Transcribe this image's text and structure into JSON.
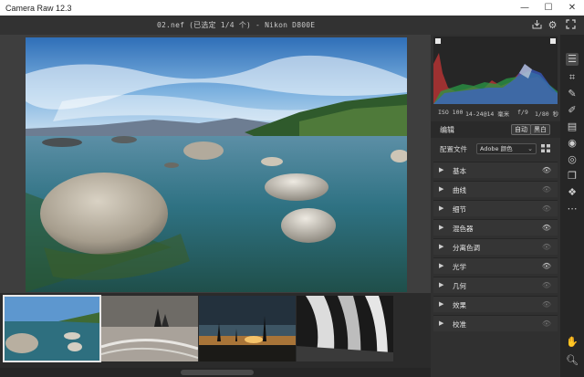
{
  "window": {
    "title": "Camera Raw 12.3",
    "controls": [
      "—",
      "☐",
      "✕"
    ]
  },
  "topbar": {
    "filename": "02.nef (已选定 1/4 个) - Nikon D800E",
    "icons": [
      "save-icon",
      "gear-icon",
      "fullscreen-icon"
    ]
  },
  "exif": {
    "iso": "ISO 100",
    "focal": "14-24@14 毫米",
    "aperture": "f/9",
    "shutter": "1/80 秒"
  },
  "edit": {
    "label": "编辑",
    "auto_label": "自动",
    "bw_label": "黑白"
  },
  "profile": {
    "label": "配置文件",
    "value": "Adobe 颜色"
  },
  "sections": [
    {
      "name": "基本",
      "eye": "bright"
    },
    {
      "name": "曲线",
      "eye": "dim"
    },
    {
      "name": "细节",
      "eye": "dim"
    },
    {
      "name": "混色器",
      "eye": "bright"
    },
    {
      "name": "分离色调",
      "eye": "dim"
    },
    {
      "name": "光学",
      "eye": "bright"
    },
    {
      "name": "几何",
      "eye": "dim"
    },
    {
      "name": "效果",
      "eye": "dim"
    },
    {
      "name": "校准",
      "eye": "dim"
    }
  ],
  "filmstrip": {
    "selected_index": 0,
    "thumbnails": [
      "lake-rocks",
      "beach-sea-stacks",
      "sunset-trees",
      "waterfall-bw"
    ]
  },
  "toolbar": {
    "tools": [
      "edit-icon",
      "crop-icon",
      "spot-removal-icon",
      "brush-icon",
      "gradient-icon",
      "radial-filter-icon",
      "red-eye-icon",
      "snapshots-icon",
      "presets-icon",
      "more-icon"
    ],
    "bottom_tools": [
      "hand-icon",
      "zoom-icon"
    ]
  },
  "colors": {
    "panel_bg": "#303030",
    "canvas_bg": "#3e3e3e",
    "accent": "#e8e8e8"
  }
}
